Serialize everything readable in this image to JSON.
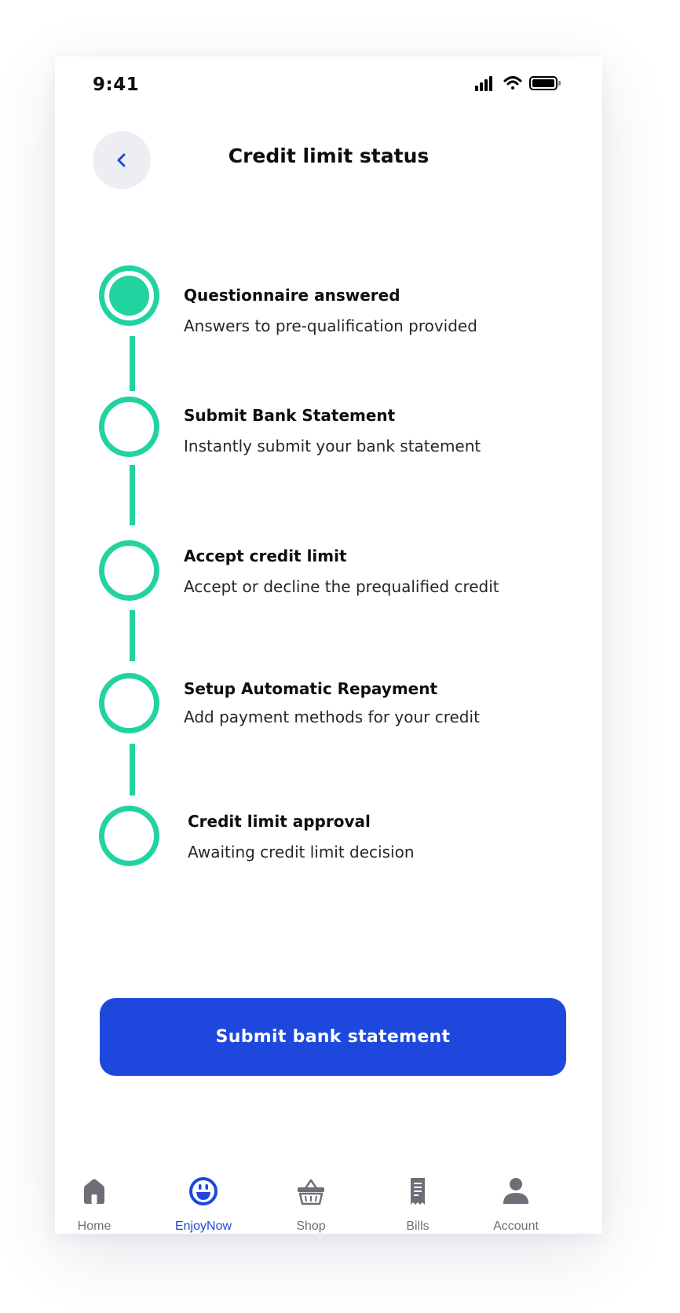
{
  "status_bar": {
    "time": "9:41"
  },
  "header": {
    "title": "Credit limit status",
    "back_icon": "chevron-left-icon"
  },
  "steps": [
    {
      "title": "Questionnaire answered",
      "description": "Answers to pre-qualification provided",
      "completed": true
    },
    {
      "title": "Submit Bank Statement",
      "description": "Instantly submit your bank statement",
      "completed": false
    },
    {
      "title": "Accept credit limit",
      "description": "Accept or decline the prequalified credit",
      "completed": false
    },
    {
      "title": "Setup Automatic Repayment",
      "description": "Add payment methods for your credit",
      "completed": false
    },
    {
      "title": "Credit limit approval",
      "description": "Awaiting credit limit decision",
      "completed": false
    }
  ],
  "primary_action": {
    "label": "Submit bank statement"
  },
  "bottom_nav": {
    "active": "EnjoyNow",
    "items": [
      {
        "label": "Home",
        "icon": "home-icon"
      },
      {
        "label": "EnjoyNow",
        "icon": "smiley-icon"
      },
      {
        "label": "Shop",
        "icon": "basket-icon"
      },
      {
        "label": "Bills",
        "icon": "receipt-icon"
      },
      {
        "label": "Account",
        "icon": "person-icon"
      }
    ]
  },
  "colors": {
    "accent_green": "#22d3a0",
    "primary_blue": "#1e48dd",
    "inactive_grey": "#6d6e77",
    "back_button_bg": "#eceef3"
  }
}
